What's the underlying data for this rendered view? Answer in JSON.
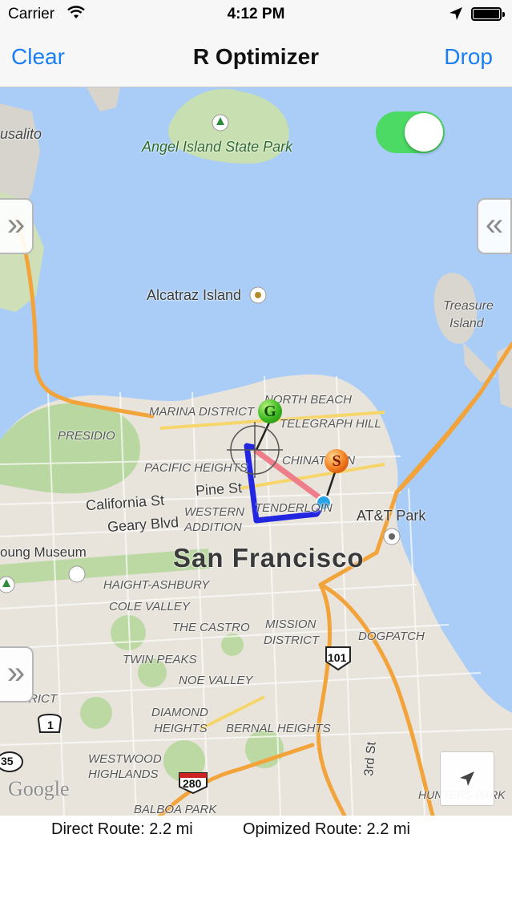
{
  "status_bar": {
    "carrier": "Carrier",
    "time": "4:12 PM",
    "wifi_icon": "wifi-icon",
    "location_icon": "location-arrow-icon",
    "battery_icon": "battery-icon"
  },
  "nav": {
    "left_button": "Clear",
    "title": "R Optimizer",
    "right_button": "Drop",
    "tint_color": "#1a7ef5"
  },
  "map": {
    "toggle_on": true,
    "toggle_color": "#4cd964",
    "labels": {
      "sausalito": "usalito",
      "angel_island": "Angel Island State Park",
      "alcatraz": "Alcatraz Island",
      "treasure_island_1": "Treasure",
      "treasure_island_2": "Island",
      "north_beach": "NORTH BEACH",
      "marina": "MARINA DISTRICT",
      "telegraph": "TELEGRAPH HILL",
      "presidio": "PRESIDIO",
      "chinatown": "CHINATOWN",
      "pacific_heights": "PACIFIC HEIGHTS",
      "california_st": "California St",
      "pine_st": "Pine St",
      "geary_blvd": "Geary Blvd",
      "western_addition_1": "WESTERN",
      "western_addition_2": "ADDITION",
      "tenderloin": "TENDERLOIN",
      "att_park": "AT&T Park",
      "young_museum": "oung Museum",
      "san_francisco": "San Francisco",
      "haight": "HAIGHT-ASHBURY",
      "cole_valley": "COLE VALLEY",
      "castro": "THE CASTRO",
      "mission_1": "MISSION",
      "mission_2": "DISTRICT",
      "dogpatch": "DOGPATCH",
      "twin_peaks": "TWIN PEAKS",
      "noe_valley": "NOE VALLEY",
      "ricts": "RICT",
      "diamond_heights_1": "DIAMOND",
      "diamond_heights_2": "HEIGHTS",
      "bernal": "BERNAL HEIGHTS",
      "westwood_1": "WESTWOOD",
      "westwood_2": "HIGHLANDS",
      "third_st": "3rd St",
      "hunters": "HUNTERS PARK",
      "balboa": "BALBOA PARK",
      "google": "Google",
      "shield_101": "101",
      "shield_1": "1",
      "shield_35": "35",
      "shield_280": "280"
    },
    "pins": {
      "goal": "G",
      "start": "S"
    },
    "route_colors": {
      "direct": "#ee7f8a",
      "optimized": "#2326e0"
    }
  },
  "footer": {
    "direct_route": "Direct Route: 2.2 mi",
    "optimized_route": "Opimized Route: 2.2 mi"
  }
}
